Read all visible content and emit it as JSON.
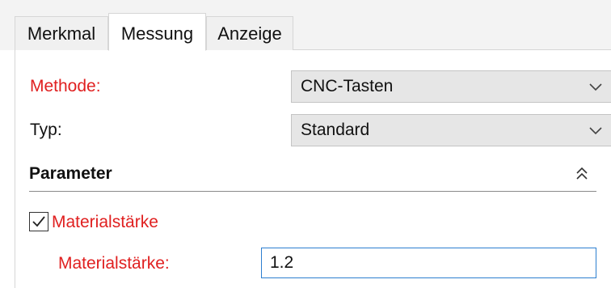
{
  "tabs": [
    {
      "label": "Merkmal",
      "active": false
    },
    {
      "label": "Messung",
      "active": true
    },
    {
      "label": "Anzeige",
      "active": false
    }
  ],
  "fields": {
    "methode": {
      "label": "Methode:",
      "value": "CNC-Tasten"
    },
    "typ": {
      "label": "Typ:",
      "value": "Standard"
    }
  },
  "parameter": {
    "title": "Parameter",
    "checkbox_label": "Materialstärke",
    "checkbox_checked": true,
    "input_label": "Materialstärke:",
    "input_value": "1.2"
  },
  "colors": {
    "required_label": "#e02020",
    "focus_border": "#2d7fd0"
  },
  "icons": {
    "dropdown": "chevron-down-icon",
    "collapse": "chevron-double-up-icon",
    "check": "check-icon"
  }
}
